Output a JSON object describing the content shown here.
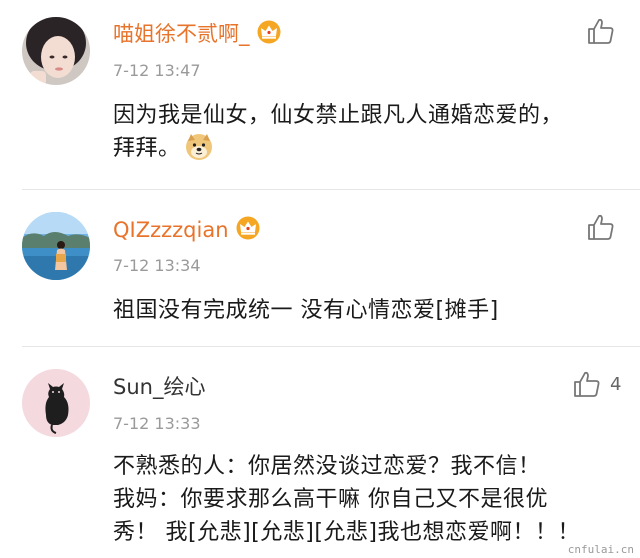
{
  "comments": [
    {
      "username": "喵姐徐不贰啊_",
      "time": "7-12 13:47",
      "text_line1": "因为我是仙女，仙女禁止跟凡人通婚恋爱的，",
      "text_line2": "拜拜。",
      "emoji_icon": "doge-emoji-icon",
      "likes": ""
    },
    {
      "username": "QIZzzzqian",
      "time": "7-12 13:34",
      "text_line1": "祖国没有完成统一 没有心情恋爱[摊手]",
      "likes": ""
    },
    {
      "username": "Sun_绘心",
      "time": "7-12 13:33",
      "text_line1": "不熟悉的人：你居然没谈过恋爱？我不信！",
      "text_line2": "我妈：你要求那么高干嘛 你自己又不是很优",
      "text_line3": "秀！ 我[允悲][允悲][允悲]我也想恋爱啊！！！",
      "likes": "4"
    }
  ],
  "watermark": "cnfulai.cn",
  "colors": {
    "vip_name": "#e8732a",
    "normal_name": "#333333",
    "time": "#9a9a9a",
    "crown": "#f5a623"
  }
}
